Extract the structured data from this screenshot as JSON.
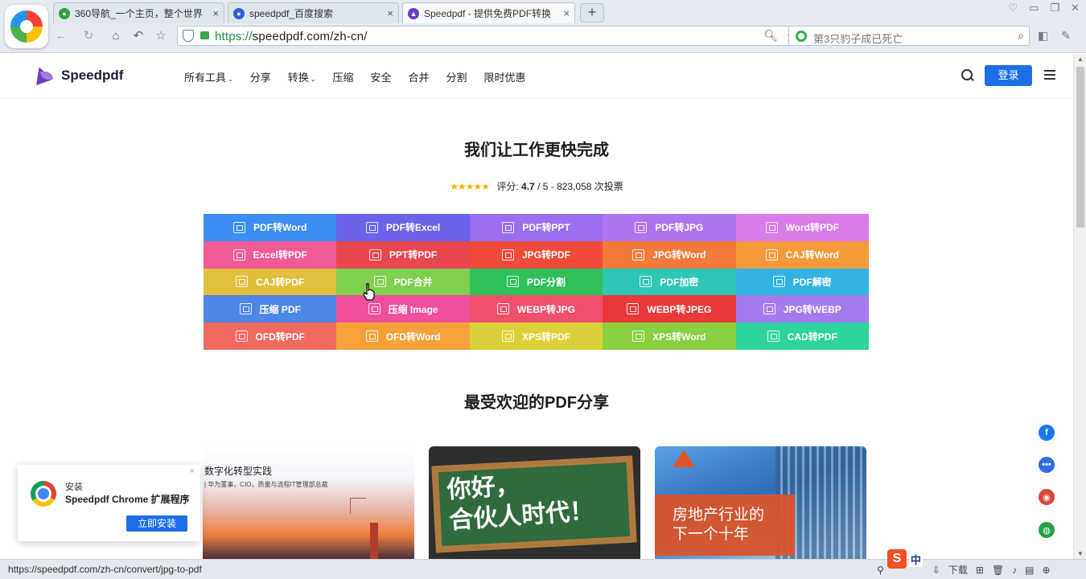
{
  "browser": {
    "tabs": [
      {
        "title": "360导航_一个主页，整个世界",
        "close": "×",
        "icon_color": "#2ea043"
      },
      {
        "title": "speedpdf_百度搜索",
        "close": "×",
        "icon_color": "#2f5fd8"
      },
      {
        "title": "Speedpdf - 提供免费PDF转换",
        "close": "×",
        "icon_color": "#6a3cbf"
      }
    ],
    "new_tab": "+",
    "url_proto": "https://",
    "url_rest": "speedpdf.com/zh-cn/",
    "search_placeholder": "第3只豹子成已死亡",
    "status_url": "https://speedpdf.com/zh-cn/convert/jpg-to-pdf",
    "status_download": "下载"
  },
  "site": {
    "brand": "Speedpdf",
    "menu": [
      {
        "label": "所有工具",
        "caret": "⌄"
      },
      {
        "label": "分享",
        "caret": ""
      },
      {
        "label": "转换",
        "caret": "⌄"
      },
      {
        "label": "压缩",
        "caret": ""
      },
      {
        "label": "安全",
        "caret": ""
      },
      {
        "label": "合并",
        "caret": ""
      },
      {
        "label": "分割",
        "caret": ""
      },
      {
        "label": "限时优惠",
        "caret": ""
      }
    ],
    "login": "登录"
  },
  "hero": {
    "title": "我们让工作更快完成",
    "stars": "★★★★★",
    "rating_prefix": "评分:",
    "rating_value": "4.7",
    "rating_rest": "/ 5 - 823,058 次投票"
  },
  "tools": [
    {
      "label": "PDF转Word",
      "color": "#3b8df0"
    },
    {
      "label": "PDF转Excel",
      "color": "#6b63e8"
    },
    {
      "label": "PDF转PPT",
      "color": "#9b6ef0"
    },
    {
      "label": "PDF转JPG",
      "color": "#b074f0"
    },
    {
      "label": "Word转PDF",
      "color": "#d97be8"
    },
    {
      "label": "Excel转PDF",
      "color": "#f05a94"
    },
    {
      "label": "PPT转PDF",
      "color": "#e8474f"
    },
    {
      "label": "JPG转PDF",
      "color": "#f04a3a"
    },
    {
      "label": "JPG转Word",
      "color": "#f47a3c"
    },
    {
      "label": "CAJ转Word",
      "color": "#f59a3a"
    },
    {
      "label": "CAJ转PDF",
      "color": "#e2c03e"
    },
    {
      "label": "PDF合并",
      "color": "#7ed04e"
    },
    {
      "label": "PDF分割",
      "color": "#2fc05a"
    },
    {
      "label": "PDF加密",
      "color": "#2ec6b4"
    },
    {
      "label": "PDF解密",
      "color": "#33b3e0"
    },
    {
      "label": "压缩 PDF",
      "color": "#4e86e8"
    },
    {
      "label": "压缩 Image",
      "color": "#f04f9a"
    },
    {
      "label": "WEBP转JPG",
      "color": "#f0506c"
    },
    {
      "label": "WEBP转JPEG",
      "color": "#e83a3a"
    },
    {
      "label": "JPG转WEBP",
      "color": "#a57cf0"
    },
    {
      "label": "OFD转PDF",
      "color": "#f06a60"
    },
    {
      "label": "OFD转Word",
      "color": "#f5a23a"
    },
    {
      "label": "XPS转PDF",
      "color": "#dcd03a"
    },
    {
      "label": "XPS转Word",
      "color": "#88d040"
    },
    {
      "label": "CAD转PDF",
      "color": "#2fd39e"
    }
  ],
  "shares": {
    "title": "最受欢迎的PDF分享",
    "card1_title": "数字化转型实践",
    "card1_sub": "| 华为董事，CIO，质量与流程IT管理部总裁",
    "card2_line1": "你好，",
    "card2_line2": "合伙人时代！",
    "card3_line1": "房地产行业的",
    "card3_line2": "下一个十年"
  },
  "ext_popup": {
    "label": "安装",
    "name": "Speedpdf Chrome 扩展程序",
    "button": "立即安装",
    "close": "×"
  },
  "social": [
    {
      "name": "facebook-icon",
      "glyph": "f",
      "color": "#1877f2"
    },
    {
      "name": "messenger-icon",
      "glyph": "•••",
      "color": "#2f6de8"
    },
    {
      "name": "chrome-icon",
      "glyph": "◉",
      "color": "#db4437"
    },
    {
      "name": "globe-icon",
      "glyph": "◍",
      "color": "#2aa144"
    }
  ],
  "ime": {
    "s": "S",
    "mode": "中"
  }
}
